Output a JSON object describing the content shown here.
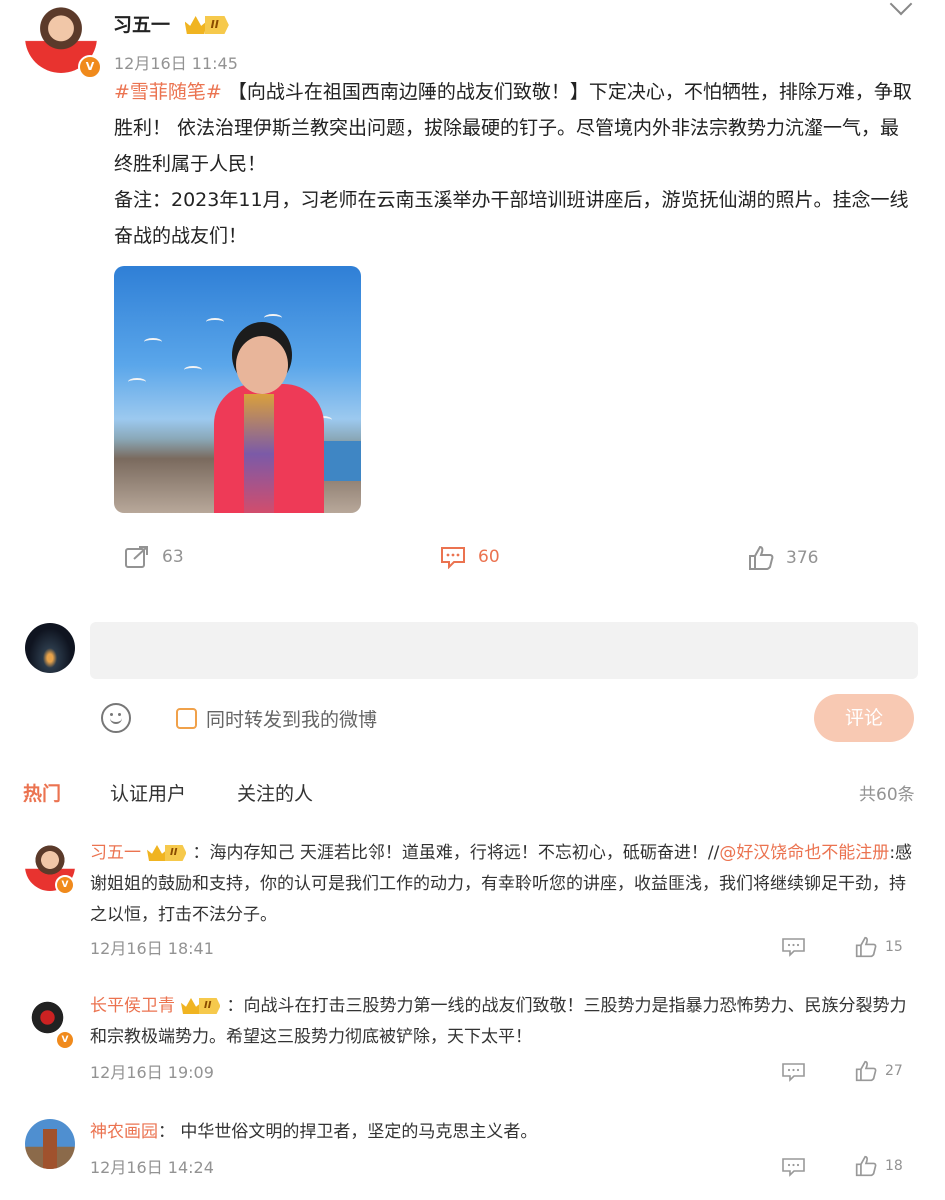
{
  "post": {
    "author": "习五一",
    "level": "II",
    "time": "12月16日 11:45",
    "hashtag": "#雪菲随笔#",
    "text_after_tag": " 【向战斗在祖国西南边陲的战友们致敬！】下定决心，不怕牺牲，排除万难，争取胜利！ 依法治理伊斯兰教突出问题，拔除最硬的钉子。尽管境内外非法宗教势力沆瀣一气，最终胜利属于人民！",
    "note": "备注：2023年11月，习老师在云南玉溪举办干部培训班讲座后，游览抚仙湖的照片。挂念一线奋战的战友们！",
    "reposts": "63",
    "comments": "60",
    "likes": "376"
  },
  "composer": {
    "forward_label": "同时转发到我的微博",
    "submit_label": "评论"
  },
  "tabs": {
    "hot": "热门",
    "verified": "认证用户",
    "following": "关注的人",
    "total": "共60条"
  },
  "comments": [
    {
      "name": "习五一",
      "level": "II",
      "text_a": "：海内存知己 天涯若比邻！道虽难，行将远！不忘初心，砥砺奋进！//",
      "mention": "@好汉饶命也不能注册",
      "text_b": ":感谢姐姐的鼓励和支持，你的认可是我们工作的动力，有幸聆听您的讲座，收益匪浅，我们将继续铆足干劲，持之以恒，打击不法分子。",
      "time": "12月16日 18:41",
      "likes": "15"
    },
    {
      "name": "长平侯卫青",
      "level": "II",
      "text": "：向战斗在打击三股势力第一线的战友们致敬！三股势力是指暴力恐怖势力、民族分裂势力和宗教极端势力。希望这三股势力彻底被铲除，天下太平！",
      "time": "12月16日 19:09",
      "likes": "27"
    },
    {
      "name": "神农画园",
      "text": "： 中华世俗文明的捍卫者，坚定的马克思主义者。",
      "time": "12月16日 14:24",
      "likes": "18"
    }
  ],
  "colors": {
    "accent": "#eb7350",
    "muted": "#939393",
    "badge": "#f08a1c"
  }
}
